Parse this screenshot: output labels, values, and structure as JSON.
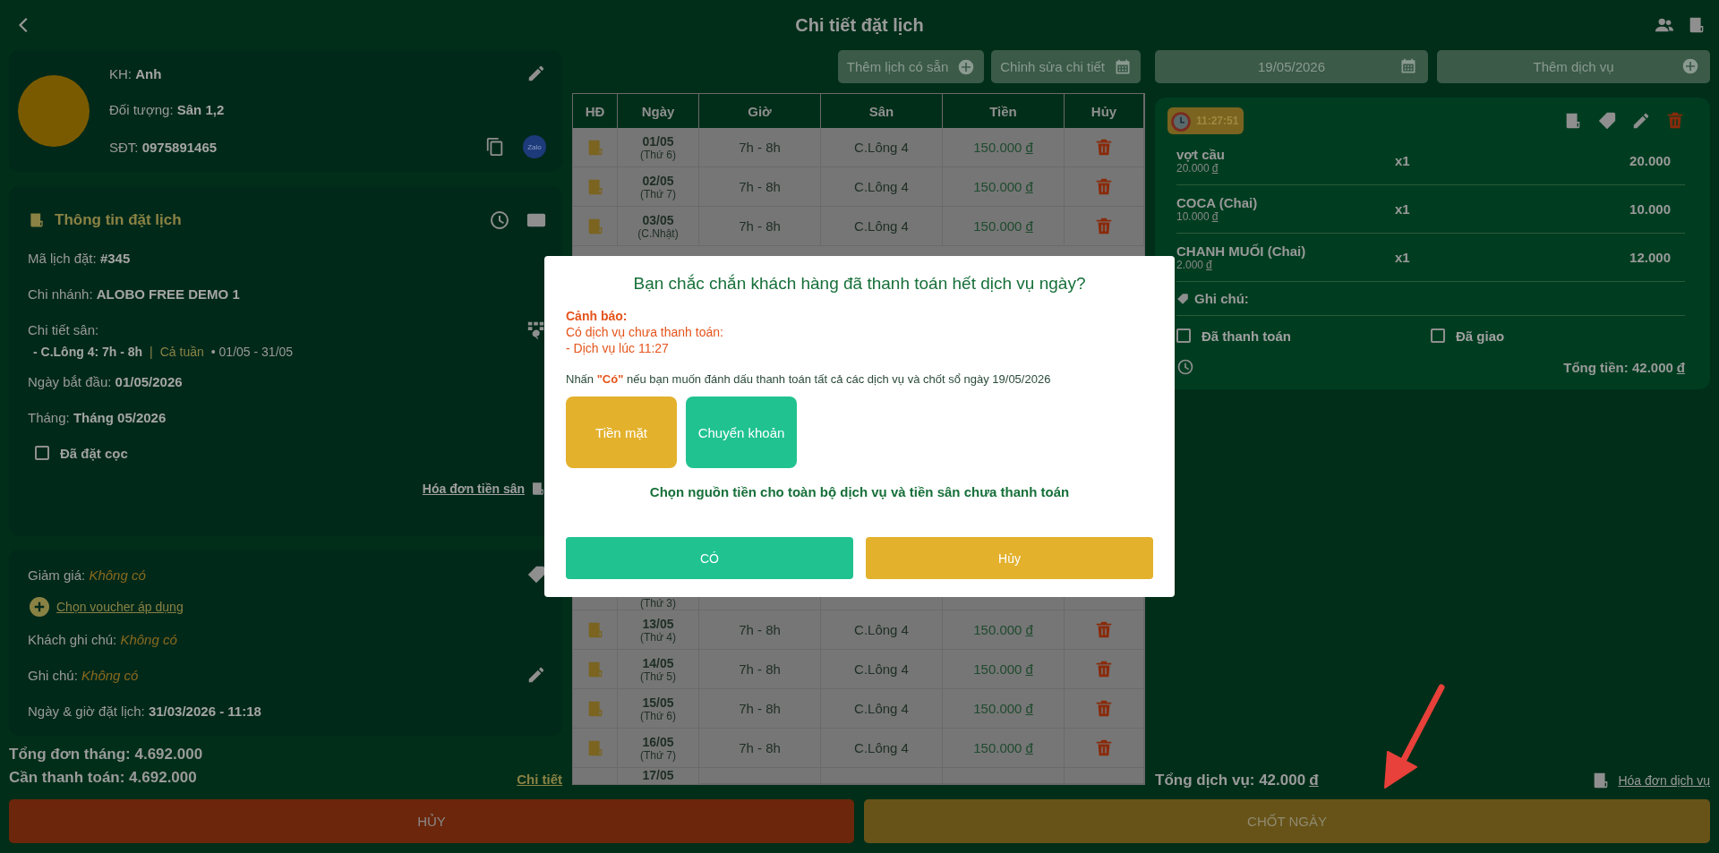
{
  "header": {
    "title": "Chi tiết đặt lịch"
  },
  "customer": {
    "name_label": "KH:",
    "name": "Anh",
    "group_label": "Đối tượng:",
    "group": "Sân 1,2",
    "phone_label": "SĐT:",
    "phone": "0975891465",
    "zalo": "Zalo"
  },
  "booking": {
    "title": "Thông tin đặt lịch",
    "fields": [
      {
        "label": "Mã lịch đặt:",
        "value": "#345"
      },
      {
        "label": "Chi nhánh:",
        "value": "ALOBO FREE DEMO 1"
      }
    ],
    "court_detail_label": "Chi tiết sân:",
    "court_line": {
      "court": "- C.Lông 4: 7h - 8h",
      "separator": "|",
      "repeat": "Cả tuần",
      "range": "• 01/05 - 31/05"
    },
    "fields_after": [
      {
        "label": "Ngày bắt đầu:",
        "value": "01/05/2026"
      },
      {
        "label": "Tháng:",
        "value": "Tháng 05/2026"
      }
    ],
    "deposit": {
      "label": "Đã đặt cọc",
      "checked": false
    },
    "invoice_link": "Hóa đơn tiền sân"
  },
  "extras": {
    "discount": {
      "label": "Giảm giá:",
      "value": "Không có"
    },
    "voucher_link": "Chọn voucher áp dụng",
    "customer_note": {
      "label": "Khách ghi chú:",
      "value": "Không có"
    },
    "note": {
      "label": "Ghi chú:",
      "value": "Không có"
    },
    "booked_at": {
      "label": "Ngày & giờ đặt lịch:",
      "value": "31/03/2026 - 11:18"
    }
  },
  "summary": {
    "month_total": "Tổng đơn tháng: 4.692.000",
    "to_pay": "Cần thanh toán: 4.692.000",
    "detail_link": "Chi tiết"
  },
  "toolbar": {
    "add_existing": "Thêm lịch có sẵn",
    "edit_detail": "Chỉnh sửa chi tiết"
  },
  "table": {
    "columns": [
      "HĐ",
      "Ngày",
      "Giờ",
      "Sân",
      "Tiền",
      "Hủy"
    ],
    "rows_top": [
      {
        "date": "01/05",
        "weekday": "(Thứ 6)",
        "time": "7h - 8h",
        "court": "C.Lông 4",
        "price": "150.000",
        "currency": "đ"
      },
      {
        "date": "02/05",
        "weekday": "(Thứ 7)",
        "time": "7h - 8h",
        "court": "C.Lông 4",
        "price": "150.000",
        "currency": "đ"
      },
      {
        "date": "03/05",
        "weekday": "(C.Nhật)",
        "time": "7h - 8h",
        "court": "C.Lông 4",
        "price": "150.000",
        "currency": "đ"
      }
    ],
    "cut_row_weekday": "(Thứ 3)",
    "rows_bottom": [
      {
        "date": "13/05",
        "weekday": "(Thứ 4)",
        "time": "7h - 8h",
        "court": "C.Lông 4",
        "price": "150.000",
        "currency": "đ"
      },
      {
        "date": "14/05",
        "weekday": "(Thứ 5)",
        "time": "7h - 8h",
        "court": "C.Lông 4",
        "price": "150.000",
        "currency": "đ"
      },
      {
        "date": "15/05",
        "weekday": "(Thứ 6)",
        "time": "7h - 8h",
        "court": "C.Lông 4",
        "price": "150.000",
        "currency": "đ"
      },
      {
        "date": "16/05",
        "weekday": "(Thứ 7)",
        "time": "7h - 8h",
        "court": "C.Lông 4",
        "price": "150.000",
        "currency": "đ"
      }
    ],
    "cut_row_date": "17/05"
  },
  "services": {
    "date": "19/05/2026",
    "add_label": "Thêm dịch vụ",
    "order": {
      "time": "11:27:51",
      "items": [
        {
          "name": "vợt cầu",
          "unit_price": "20.000",
          "currency": "đ",
          "qty": "x1",
          "amount": "20.000"
        },
        {
          "name": "COCA (Chai)",
          "unit_price": "10.000",
          "currency": "đ",
          "qty": "x1",
          "amount": "10.000"
        },
        {
          "name": "CHANH MUỐI (Chai)",
          "unit_price": "2.000",
          "currency": "đ",
          "qty": "x1",
          "amount": "12.000"
        }
      ],
      "note_label": "Ghi chú:",
      "paid": {
        "label": "Đã thanh toán",
        "checked": false
      },
      "delivered": {
        "label": "Đã giao",
        "checked": false
      },
      "total": "Tổng tiền: 42.000",
      "total_currency": "đ"
    },
    "footer_total": "Tổng dịch vụ: 42.000",
    "footer_currency": "đ",
    "invoice_link": "Hóa đơn dịch vụ"
  },
  "actions": {
    "cancel": "HỦY",
    "close_day": "CHỐT NGÀY"
  },
  "dialog": {
    "title": "Bạn chắc chắn khách hàng đã thanh toán hết dịch vụ ngày?",
    "warning_title": "Cảnh báo:",
    "warning_lines": [
      "Có dịch vụ chưa thanh toán:",
      "- Dịch vụ lúc 11:27"
    ],
    "message": "Nhấn **\"Có\"** nếu bạn muốn đánh dấu thanh toán tất cả các dịch vụ và chốt sổ ngày 19/05/2026",
    "payment_options": [
      {
        "label": "Tiền mặt",
        "kind": "cash"
      },
      {
        "label": "Chuyển khoản",
        "kind": "transfer"
      }
    ],
    "hint": "Chọn nguồn tiền cho toàn bộ dịch vụ và tiền sân chưa thanh toán",
    "confirm": "CÓ",
    "cancel": "Hủy"
  }
}
